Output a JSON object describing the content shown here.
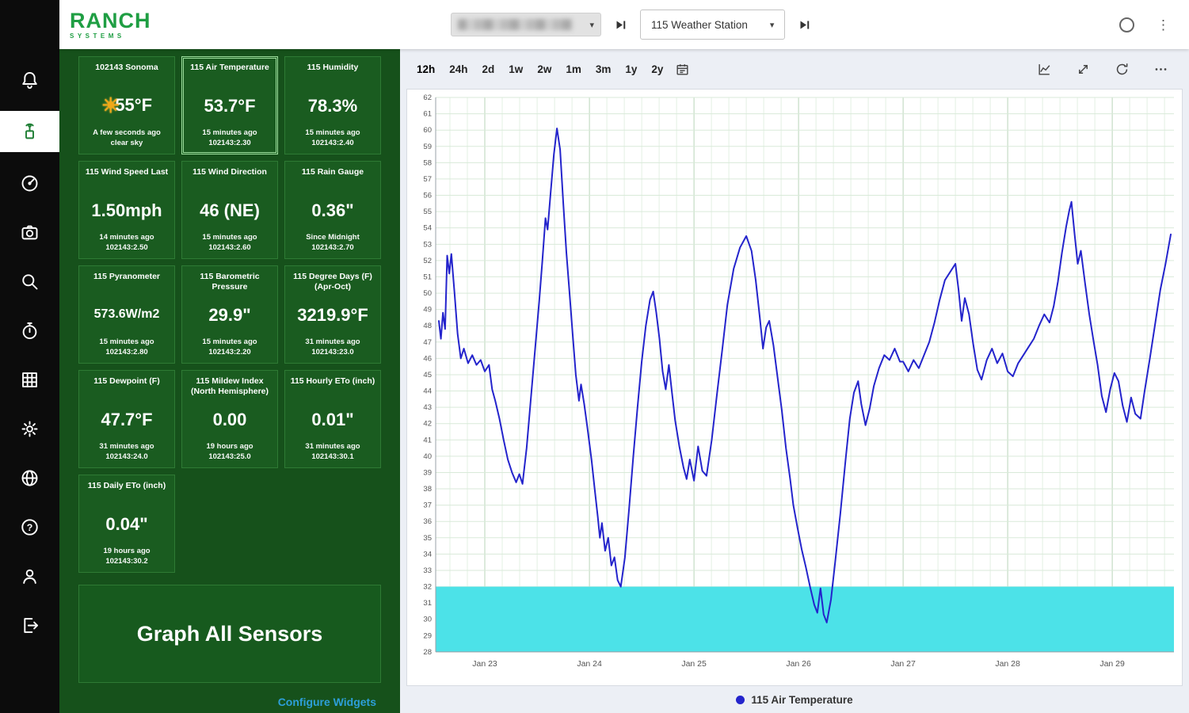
{
  "logo": {
    "title": "RANCH",
    "subtitle": "SYSTEMS",
    "color": "#1f9e43"
  },
  "sidebar": {
    "items": [
      {
        "name": "notifications",
        "icon": "bell-icon",
        "selected": false
      },
      {
        "name": "sensors",
        "icon": "sensor-station-icon",
        "selected": true
      },
      {
        "name": "dashboard",
        "icon": "dashboard-icon",
        "selected": false
      },
      {
        "name": "cameras",
        "icon": "camera-icon",
        "selected": false
      },
      {
        "name": "search",
        "icon": "search-icon",
        "selected": false
      },
      {
        "name": "schedules",
        "icon": "timer-icon",
        "selected": false
      },
      {
        "name": "reports",
        "icon": "data-table-icon",
        "selected": false
      },
      {
        "name": "settings",
        "icon": "settings-icon",
        "selected": false
      },
      {
        "name": "web",
        "icon": "globe-icon",
        "selected": false
      },
      {
        "name": "help",
        "icon": "help-icon",
        "selected": false
      },
      {
        "name": "account",
        "icon": "user-icon",
        "selected": false
      },
      {
        "name": "logout",
        "icon": "logout-icon",
        "selected": false
      }
    ]
  },
  "header": {
    "org_selector": {
      "redacted": true,
      "label": ""
    },
    "station_selector": "115 Weather Station"
  },
  "panel": {
    "graph_all_label": "Graph All Sensors",
    "configure_label": "Configure Widgets",
    "tiles": [
      {
        "title": "102143 Sonoma",
        "value": "55°F",
        "meta1": "A few seconds ago",
        "meta2": "clear sky",
        "weather": true
      },
      {
        "title": "115 Air Temperature",
        "value": "53.7°F",
        "meta1": "15 minutes ago",
        "meta2": "102143:2.30",
        "selected": true
      },
      {
        "title": "115 Humidity",
        "value": "78.3%",
        "meta1": "15 minutes ago",
        "meta2": "102143:2.40"
      },
      {
        "title": "115 Wind Speed Last",
        "value": "1.50mph",
        "meta1": "14 minutes ago",
        "meta2": "102143:2.50"
      },
      {
        "title": "115 Wind Direction",
        "value": "46 (NE)",
        "meta1": "15 minutes ago",
        "meta2": "102143:2.60"
      },
      {
        "title": "115 Rain Gauge",
        "value": "0.36\"",
        "meta1": "Since Midnight",
        "meta2": "102143:2.70"
      },
      {
        "title": "115 Pyranometer",
        "value": "573.6W/m2",
        "meta1": "15 minutes ago",
        "meta2": "102143:2.80"
      },
      {
        "title": "115 Barometric Pressure",
        "value": "29.9\"",
        "meta1": "15 minutes ago",
        "meta2": "102143:2.20"
      },
      {
        "title": "115 Degree Days (F)(Apr-Oct)",
        "value": "3219.9°F",
        "meta1": "31 minutes ago",
        "meta2": "102143:23.0"
      },
      {
        "title": "115 Dewpoint (F)",
        "value": "47.7°F",
        "meta1": "31 minutes ago",
        "meta2": "102143:24.0"
      },
      {
        "title": "115 Mildew Index (North Hemisphere)",
        "value": "0.00",
        "meta1": "19 hours ago",
        "meta2": "102143:25.0"
      },
      {
        "title": "115 Hourly ETo (inch)",
        "value": "0.01\"",
        "meta1": "31 minutes ago",
        "meta2": "102143:30.1"
      },
      {
        "title": "115 Daily ETo (inch)",
        "value": "0.04\"",
        "meta1": "19 hours ago",
        "meta2": "102143:30.2"
      }
    ]
  },
  "toolbar": {
    "ranges": [
      "12h",
      "24h",
      "2d",
      "1w",
      "2w",
      "1m",
      "3m",
      "1y",
      "2y"
    ],
    "selected_range": "12h"
  },
  "chart_data": {
    "type": "line",
    "title": "",
    "xlabel": "",
    "ylabel": "",
    "ylim": [
      28,
      62
    ],
    "y_tick_step": 1,
    "x_domain": [
      22.53,
      29.59
    ],
    "x_ticks": [
      {
        "t": 23,
        "label": "Jan 23"
      },
      {
        "t": 24,
        "label": "Jan 24"
      },
      {
        "t": 25,
        "label": "Jan 25"
      },
      {
        "t": 26,
        "label": "Jan 26"
      },
      {
        "t": 27,
        "label": "Jan 27"
      },
      {
        "t": 28,
        "label": "Jan 28"
      },
      {
        "t": 29,
        "label": "Jan 29"
      }
    ],
    "grid": true,
    "bands": [
      {
        "from": 28,
        "to": 32,
        "color": "#4ce2e8",
        "meaning": "freeze-band"
      }
    ],
    "legend": {
      "position": "bottom"
    },
    "series": [
      {
        "name": "115 Air Temperature",
        "color": "#2424cc",
        "unit": "°F",
        "points": [
          [
            22.56,
            48.3
          ],
          [
            22.58,
            47.2
          ],
          [
            22.6,
            48.8
          ],
          [
            22.62,
            47.8
          ],
          [
            22.64,
            52.3
          ],
          [
            22.66,
            51.2
          ],
          [
            22.68,
            52.4
          ],
          [
            22.71,
            50.0
          ],
          [
            22.74,
            47.5
          ],
          [
            22.77,
            46.0
          ],
          [
            22.8,
            46.6
          ],
          [
            22.84,
            45.7
          ],
          [
            22.88,
            46.2
          ],
          [
            22.92,
            45.6
          ],
          [
            22.96,
            45.9
          ],
          [
            23.0,
            45.2
          ],
          [
            23.04,
            45.6
          ],
          [
            23.07,
            44.1
          ],
          [
            23.1,
            43.4
          ],
          [
            23.14,
            42.3
          ],
          [
            23.18,
            41.0
          ],
          [
            23.22,
            39.8
          ],
          [
            23.26,
            39.0
          ],
          [
            23.3,
            38.4
          ],
          [
            23.33,
            38.9
          ],
          [
            23.36,
            38.3
          ],
          [
            23.4,
            40.5
          ],
          [
            23.44,
            43.5
          ],
          [
            23.48,
            46.5
          ],
          [
            23.52,
            49.5
          ],
          [
            23.55,
            52.0
          ],
          [
            23.58,
            54.6
          ],
          [
            23.6,
            53.9
          ],
          [
            23.63,
            56.2
          ],
          [
            23.66,
            58.5
          ],
          [
            23.69,
            60.1
          ],
          [
            23.72,
            58.8
          ],
          [
            23.75,
            55.5
          ],
          [
            23.78,
            52.5
          ],
          [
            23.81,
            50.0
          ],
          [
            23.84,
            47.5
          ],
          [
            23.87,
            45.0
          ],
          [
            23.9,
            43.4
          ],
          [
            23.92,
            44.4
          ],
          [
            23.95,
            43.2
          ],
          [
            23.98,
            41.8
          ],
          [
            24.02,
            39.8
          ],
          [
            24.05,
            38.0
          ],
          [
            24.08,
            36.3
          ],
          [
            24.1,
            35.0
          ],
          [
            24.12,
            35.9
          ],
          [
            24.15,
            34.2
          ],
          [
            24.18,
            35.0
          ],
          [
            24.21,
            33.3
          ],
          [
            24.24,
            33.8
          ],
          [
            24.27,
            32.4
          ],
          [
            24.3,
            32.0
          ],
          [
            24.34,
            33.8
          ],
          [
            24.38,
            36.8
          ],
          [
            24.42,
            40.0
          ],
          [
            24.46,
            43.0
          ],
          [
            24.5,
            45.8
          ],
          [
            24.54,
            48.0
          ],
          [
            24.58,
            49.6
          ],
          [
            24.61,
            50.1
          ],
          [
            24.64,
            48.8
          ],
          [
            24.67,
            47.2
          ],
          [
            24.7,
            45.2
          ],
          [
            24.73,
            44.1
          ],
          [
            24.76,
            45.6
          ],
          [
            24.79,
            43.9
          ],
          [
            24.82,
            42.2
          ],
          [
            24.86,
            40.6
          ],
          [
            24.9,
            39.3
          ],
          [
            24.93,
            38.6
          ],
          [
            24.96,
            39.8
          ],
          [
            25.0,
            38.5
          ],
          [
            25.04,
            40.6
          ],
          [
            25.08,
            39.1
          ],
          [
            25.12,
            38.8
          ],
          [
            25.17,
            41.0
          ],
          [
            25.22,
            43.8
          ],
          [
            25.27,
            46.5
          ],
          [
            25.32,
            49.3
          ],
          [
            25.38,
            51.5
          ],
          [
            25.44,
            52.8
          ],
          [
            25.5,
            53.5
          ],
          [
            25.55,
            52.6
          ],
          [
            25.59,
            50.8
          ],
          [
            25.63,
            48.5
          ],
          [
            25.66,
            46.6
          ],
          [
            25.69,
            47.9
          ],
          [
            25.72,
            48.3
          ],
          [
            25.76,
            46.8
          ],
          [
            25.8,
            44.8
          ],
          [
            25.84,
            42.8
          ],
          [
            25.88,
            40.5
          ],
          [
            25.92,
            38.6
          ],
          [
            25.95,
            37.0
          ],
          [
            25.99,
            35.6
          ],
          [
            26.03,
            34.3
          ],
          [
            26.07,
            33.2
          ],
          [
            26.11,
            32.0
          ],
          [
            26.15,
            30.9
          ],
          [
            26.18,
            30.4
          ],
          [
            26.21,
            31.9
          ],
          [
            26.24,
            30.3
          ],
          [
            26.27,
            29.8
          ],
          [
            26.31,
            31.2
          ],
          [
            26.35,
            33.5
          ],
          [
            26.4,
            36.5
          ],
          [
            26.45,
            39.8
          ],
          [
            26.49,
            42.3
          ],
          [
            26.53,
            43.9
          ],
          [
            26.57,
            44.6
          ],
          [
            26.6,
            43.2
          ],
          [
            26.64,
            41.9
          ],
          [
            26.68,
            42.9
          ],
          [
            26.72,
            44.3
          ],
          [
            26.77,
            45.4
          ],
          [
            26.82,
            46.2
          ],
          [
            26.87,
            45.9
          ],
          [
            26.92,
            46.6
          ],
          [
            26.97,
            45.8
          ],
          [
            27.0,
            45.8
          ],
          [
            27.05,
            45.2
          ],
          [
            27.1,
            45.9
          ],
          [
            27.15,
            45.4
          ],
          [
            27.2,
            46.2
          ],
          [
            27.25,
            47.0
          ],
          [
            27.3,
            48.2
          ],
          [
            27.35,
            49.6
          ],
          [
            27.4,
            50.8
          ],
          [
            27.45,
            51.3
          ],
          [
            27.5,
            51.8
          ],
          [
            27.53,
            50.2
          ],
          [
            27.56,
            48.3
          ],
          [
            27.59,
            49.7
          ],
          [
            27.63,
            48.7
          ],
          [
            27.67,
            46.9
          ],
          [
            27.71,
            45.3
          ],
          [
            27.75,
            44.7
          ],
          [
            27.8,
            45.9
          ],
          [
            27.85,
            46.6
          ],
          [
            27.9,
            45.7
          ],
          [
            27.95,
            46.3
          ],
          [
            28.0,
            45.2
          ],
          [
            28.05,
            44.9
          ],
          [
            28.1,
            45.7
          ],
          [
            28.15,
            46.2
          ],
          [
            28.2,
            46.7
          ],
          [
            28.25,
            47.2
          ],
          [
            28.3,
            48.0
          ],
          [
            28.35,
            48.7
          ],
          [
            28.4,
            48.2
          ],
          [
            28.44,
            49.2
          ],
          [
            28.48,
            50.7
          ],
          [
            28.52,
            52.5
          ],
          [
            28.56,
            54.1
          ],
          [
            28.59,
            55.1
          ],
          [
            28.61,
            55.6
          ],
          [
            28.64,
            53.6
          ],
          [
            28.67,
            51.8
          ],
          [
            28.7,
            52.6
          ],
          [
            28.74,
            50.6
          ],
          [
            28.78,
            48.7
          ],
          [
            28.82,
            47.1
          ],
          [
            28.86,
            45.6
          ],
          [
            28.9,
            43.7
          ],
          [
            28.94,
            42.7
          ],
          [
            28.98,
            44.1
          ],
          [
            29.02,
            45.1
          ],
          [
            29.06,
            44.6
          ],
          [
            29.1,
            43.1
          ],
          [
            29.14,
            42.1
          ],
          [
            29.18,
            43.6
          ],
          [
            29.22,
            42.6
          ],
          [
            29.27,
            42.3
          ],
          [
            29.31,
            44.0
          ],
          [
            29.36,
            46.0
          ],
          [
            29.41,
            48.1
          ],
          [
            29.46,
            50.2
          ],
          [
            29.51,
            51.8
          ],
          [
            29.56,
            53.6
          ]
        ]
      }
    ]
  }
}
